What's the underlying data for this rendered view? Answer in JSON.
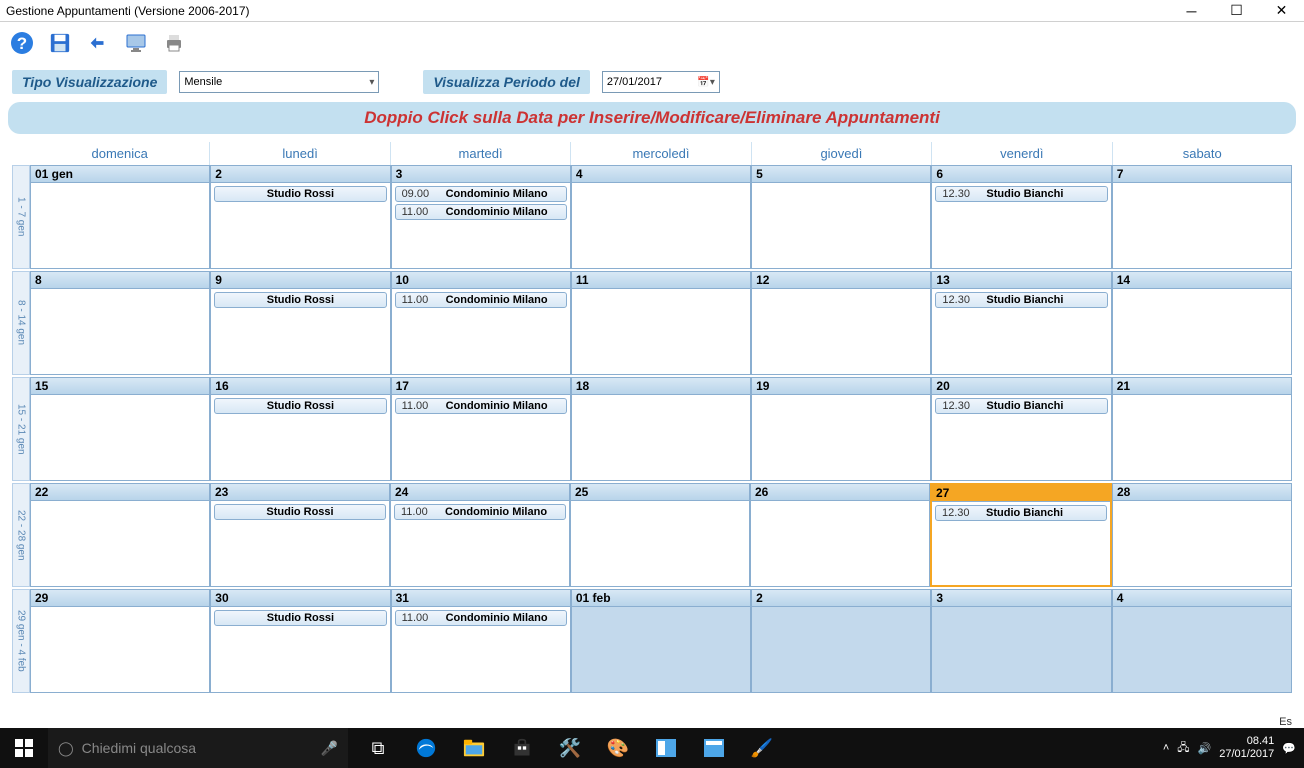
{
  "window": {
    "title": "Gestione Appuntamenti (Versione 2006-2017)"
  },
  "controls": {
    "viz_label": "Tipo Visualizzazione",
    "viz_value": "Mensile",
    "period_label": "Visualizza Periodo del",
    "date_value": "27/01/2017"
  },
  "instruction": "Doppio Click sulla Data per Inserire/Modificare/Eliminare Appuntamenti",
  "day_names": [
    "domenica",
    "lunedì",
    "martedì",
    "mercoledì",
    "giovedì",
    "venerdì",
    "sabato"
  ],
  "weeks": [
    {
      "label": "1 - 7 gen",
      "days": [
        {
          "num": "01 gen",
          "today": false,
          "other": false,
          "appts": []
        },
        {
          "num": "2",
          "today": false,
          "other": false,
          "appts": [
            {
              "time": "",
              "title": "Studio Rossi"
            }
          ]
        },
        {
          "num": "3",
          "today": false,
          "other": false,
          "appts": [
            {
              "time": "09.00",
              "title": "Condominio Milano"
            },
            {
              "time": "11.00",
              "title": "Condominio Milano"
            }
          ]
        },
        {
          "num": "4",
          "today": false,
          "other": false,
          "appts": []
        },
        {
          "num": "5",
          "today": false,
          "other": false,
          "appts": []
        },
        {
          "num": "6",
          "today": false,
          "other": false,
          "appts": [
            {
              "time": "12.30",
              "title": "Studio Bianchi"
            }
          ]
        },
        {
          "num": "7",
          "today": false,
          "other": false,
          "appts": []
        }
      ]
    },
    {
      "label": "8 - 14 gen",
      "days": [
        {
          "num": "8",
          "today": false,
          "other": false,
          "appts": []
        },
        {
          "num": "9",
          "today": false,
          "other": false,
          "appts": [
            {
              "time": "",
              "title": "Studio Rossi"
            }
          ]
        },
        {
          "num": "10",
          "today": false,
          "other": false,
          "appts": [
            {
              "time": "11.00",
              "title": "Condominio Milano"
            }
          ]
        },
        {
          "num": "11",
          "today": false,
          "other": false,
          "appts": []
        },
        {
          "num": "12",
          "today": false,
          "other": false,
          "appts": []
        },
        {
          "num": "13",
          "today": false,
          "other": false,
          "appts": [
            {
              "time": "12.30",
              "title": "Studio Bianchi"
            }
          ]
        },
        {
          "num": "14",
          "today": false,
          "other": false,
          "appts": []
        }
      ]
    },
    {
      "label": "15 - 21 gen",
      "days": [
        {
          "num": "15",
          "today": false,
          "other": false,
          "appts": []
        },
        {
          "num": "16",
          "today": false,
          "other": false,
          "appts": [
            {
              "time": "",
              "title": "Studio Rossi"
            }
          ]
        },
        {
          "num": "17",
          "today": false,
          "other": false,
          "appts": [
            {
              "time": "11.00",
              "title": "Condominio Milano"
            }
          ]
        },
        {
          "num": "18",
          "today": false,
          "other": false,
          "appts": []
        },
        {
          "num": "19",
          "today": false,
          "other": false,
          "appts": []
        },
        {
          "num": "20",
          "today": false,
          "other": false,
          "appts": [
            {
              "time": "12.30",
              "title": "Studio Bianchi"
            }
          ]
        },
        {
          "num": "21",
          "today": false,
          "other": false,
          "appts": []
        }
      ]
    },
    {
      "label": "22 - 28 gen",
      "days": [
        {
          "num": "22",
          "today": false,
          "other": false,
          "appts": []
        },
        {
          "num": "23",
          "today": false,
          "other": false,
          "appts": [
            {
              "time": "",
              "title": "Studio Rossi"
            }
          ]
        },
        {
          "num": "24",
          "today": false,
          "other": false,
          "appts": [
            {
              "time": "11.00",
              "title": "Condominio Milano"
            }
          ]
        },
        {
          "num": "25",
          "today": false,
          "other": false,
          "appts": []
        },
        {
          "num": "26",
          "today": false,
          "other": false,
          "appts": []
        },
        {
          "num": "27",
          "today": true,
          "other": false,
          "appts": [
            {
              "time": "12.30",
              "title": "Studio Bianchi"
            }
          ]
        },
        {
          "num": "28",
          "today": false,
          "other": false,
          "appts": []
        }
      ]
    },
    {
      "label": "29 gen - 4 feb",
      "days": [
        {
          "num": "29",
          "today": false,
          "other": false,
          "appts": []
        },
        {
          "num": "30",
          "today": false,
          "other": false,
          "appts": [
            {
              "time": "",
              "title": "Studio Rossi"
            }
          ]
        },
        {
          "num": "31",
          "today": false,
          "other": false,
          "appts": [
            {
              "time": "11.00",
              "title": "Condominio Milano"
            }
          ]
        },
        {
          "num": "01 feb",
          "today": false,
          "other": true,
          "appts": []
        },
        {
          "num": "2",
          "today": false,
          "other": true,
          "appts": []
        },
        {
          "num": "3",
          "today": false,
          "other": true,
          "appts": []
        },
        {
          "num": "4",
          "today": false,
          "other": true,
          "appts": []
        }
      ]
    }
  ],
  "statusbar": {
    "text": "Es"
  },
  "taskbar": {
    "search_placeholder": "Chiedimi qualcosa",
    "time": "08.41",
    "date": "27/01/2017"
  }
}
